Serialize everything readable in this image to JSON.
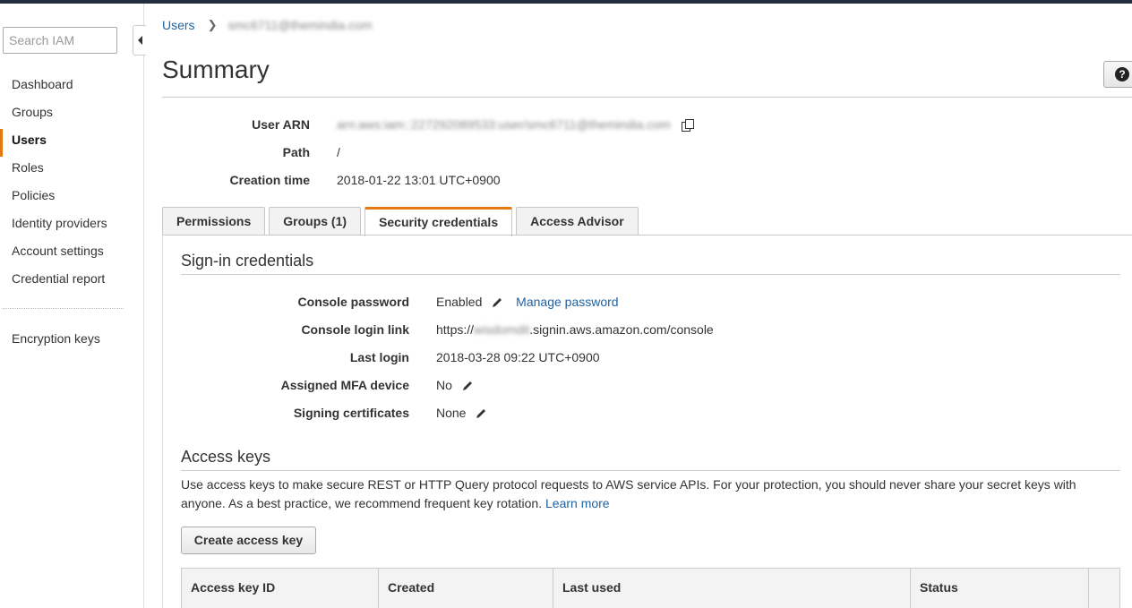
{
  "sidebar": {
    "search_placeholder": "Search IAM",
    "items": [
      {
        "label": "Dashboard"
      },
      {
        "label": "Groups"
      },
      {
        "label": "Users"
      },
      {
        "label": "Roles"
      },
      {
        "label": "Policies"
      },
      {
        "label": "Identity providers"
      },
      {
        "label": "Account settings"
      },
      {
        "label": "Credential report"
      }
    ],
    "active_item": "Users",
    "extra_item": "Encryption keys"
  },
  "breadcrumb": {
    "root": "Users",
    "current": "smc6711@themindia.com"
  },
  "page": {
    "title": "Summary",
    "help_icon": "question-circle-icon"
  },
  "summary": {
    "user_arn_label": "User ARN",
    "user_arn": "arn:aws:iam::227292089533:user/smc6711@themindia.com",
    "path_label": "Path",
    "path": "/",
    "creation_label": "Creation time",
    "creation_time": "2018-01-22 13:01 UTC+0900"
  },
  "tabs": [
    {
      "label": "Permissions"
    },
    {
      "label": "Groups (1)"
    },
    {
      "label": "Security credentials"
    },
    {
      "label": "Access Advisor"
    }
  ],
  "active_tab": "Security credentials",
  "signin": {
    "heading": "Sign-in credentials",
    "console_password_label": "Console password",
    "console_password": "Enabled",
    "manage_password_link": "Manage password",
    "login_link_label": "Console login link",
    "login_link_prefix": "https://",
    "login_link_hidden": "wisdomdit",
    "login_link_suffix": ".signin.aws.amazon.com/console",
    "last_login_label": "Last login",
    "last_login": "2018-03-28 09:22 UTC+0900",
    "mfa_label": "Assigned MFA device",
    "mfa": "No",
    "certs_label": "Signing certificates",
    "certs": "None"
  },
  "access_keys": {
    "heading": "Access keys",
    "description": "Use access keys to make secure REST or HTTP Query protocol requests to AWS service APIs. For your protection, you should never share your secret keys with anyone. As a best practice, we recommend frequent key rotation.",
    "learn_more": "Learn more",
    "create_button": "Create access key",
    "columns": [
      "Access key ID",
      "Created",
      "Last used",
      "Status",
      ""
    ]
  },
  "colors": {
    "accent": "#e47911",
    "link": "#2162a1",
    "topbar": "#232f3e"
  }
}
